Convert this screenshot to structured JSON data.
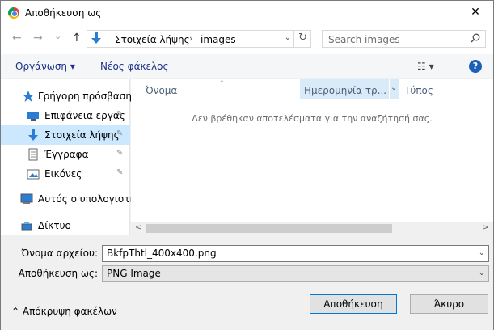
{
  "window": {
    "title": "Αποθήκευση ως",
    "close_glyph": "✕"
  },
  "nav": {
    "back_glyph": "←",
    "forward_glyph": "→",
    "recent_glyph": "⌄",
    "up_glyph": "↑",
    "breadcrumbs": [
      "Στοιχεία λήψης",
      "images"
    ],
    "breadcrumb_sep": "›",
    "dropdown_glyph": "⌄",
    "refresh_glyph": "↻",
    "search_placeholder": "Search images"
  },
  "commands": {
    "organize": "Οργάνωση ▾",
    "new_folder": "Νέος φάκελος",
    "view_glyph": "☷ ▾",
    "help_glyph": "?"
  },
  "sidebar": {
    "items": [
      {
        "label": "Γρήγορη πρόσβαση",
        "icon": "star-icon",
        "pinned": false,
        "selected": false
      },
      {
        "label": "Επιφάνεια εργας",
        "icon": "desktop-icon",
        "pinned": true,
        "selected": false
      },
      {
        "label": "Στοιχεία λήψης",
        "icon": "download-icon",
        "pinned": true,
        "selected": true
      },
      {
        "label": "Έγγραφα",
        "icon": "documents-icon",
        "pinned": true,
        "selected": false
      },
      {
        "label": "Εικόνες",
        "icon": "pictures-icon",
        "pinned": true,
        "selected": false
      },
      {
        "label": "Αυτός ο υπολογιστή",
        "icon": "computer-icon",
        "pinned": false,
        "selected": false
      },
      {
        "label": "Δίκτυο",
        "icon": "network-icon",
        "pinned": false,
        "selected": false
      }
    ],
    "pin_glyph": "📌"
  },
  "columns": {
    "name": "Όνομα",
    "date": "Ημερομηνία τρ...",
    "type": "Τύπος",
    "sort_glyph": "⌃",
    "dd_glyph": "⌄"
  },
  "content": {
    "empty_message": "Δεν βρέθηκαν αποτελέσματα για την αναζήτησή σας."
  },
  "scrollbar": {
    "left_glyph": "<",
    "right_glyph": ">"
  },
  "form": {
    "filename_label": "Όνομα αρχείου:",
    "filename_value": "BkfpThtl_400x400.png",
    "filetype_label": "Αποθήκευση ως:",
    "filetype_value": "PNG Image",
    "dd_glyph": "⌄"
  },
  "footer": {
    "hide_folders": "⌃  Απόκρυψη φακέλων",
    "save": "Αποθήκευση",
    "cancel": "Άκυρο"
  },
  "colors": {
    "accent": "#0078d7",
    "selection": "#cce8ff",
    "link": "#1e3287"
  }
}
